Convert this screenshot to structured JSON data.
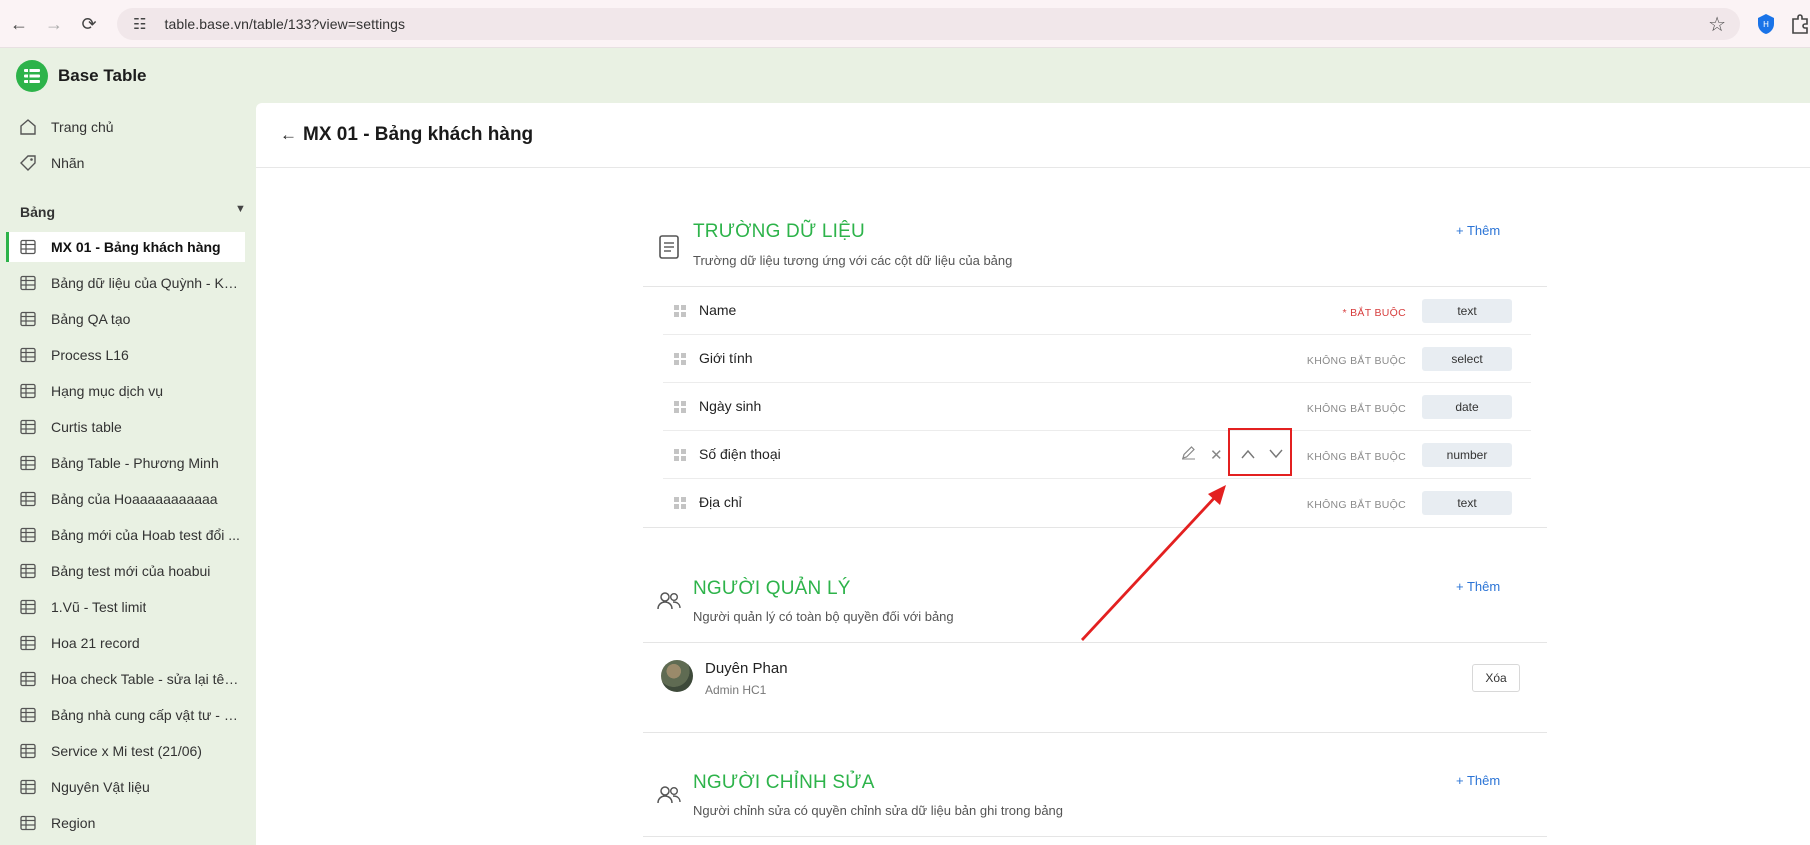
{
  "browser": {
    "url": "table.base.vn/table/133?view=settings"
  },
  "app": {
    "title": "Base Table",
    "brand_color": "#2db34a"
  },
  "sidebar": {
    "top_items": [
      {
        "label": "Trang chủ",
        "icon": "home-icon"
      },
      {
        "label": "Nhãn",
        "icon": "tag-icon"
      }
    ],
    "section_label": "Bảng",
    "tables": [
      {
        "label": "MX 01 - Bảng khách hàng",
        "active": true
      },
      {
        "label": "Bảng dữ liệu của Quỳnh - KH..."
      },
      {
        "label": "Bảng QA tạo"
      },
      {
        "label": "Process L16"
      },
      {
        "label": "Hạng mục dịch vụ"
      },
      {
        "label": "Curtis table"
      },
      {
        "label": "Bảng Table - Phương Minh"
      },
      {
        "label": "Bảng của Hoaaaaaaaaaaa"
      },
      {
        "label": "Bảng mới của Hoab test đổi ..."
      },
      {
        "label": "Bảng test mới của hoabui"
      },
      {
        "label": "1.Vũ - Test limit"
      },
      {
        "label": "Hoa 21 record"
      },
      {
        "label": "Hoa check Table - sửa lại tên..."
      },
      {
        "label": "Bảng nhà cung cấp vật tư - CE"
      },
      {
        "label": "Service x Mi test (21/06)"
      },
      {
        "label": "Nguyên Vật liệu"
      },
      {
        "label": "Region"
      }
    ]
  },
  "page": {
    "title": "MX 01 - Bảng khách hàng"
  },
  "fields_section": {
    "title": "TRƯỜNG DỮ LIỆU",
    "description": "Trường dữ liệu tương ứng với các cột dữ liệu của bảng",
    "add_label": "+ Thêm",
    "fields": [
      {
        "name": "Name",
        "requirement": "* BẮT BUỘC",
        "required": true,
        "type": "text"
      },
      {
        "name": "Giới tính",
        "requirement": "KHÔNG BẮT BUỘC",
        "required": false,
        "type": "select"
      },
      {
        "name": "Ngày sinh",
        "requirement": "KHÔNG BẮT BUỘC",
        "required": false,
        "type": "date"
      },
      {
        "name": "Số điện thoại",
        "requirement": "KHÔNG BẮT BUỘC",
        "required": false,
        "type": "number"
      },
      {
        "name": "Địa chỉ",
        "requirement": "KHÔNG BẮT BUỘC",
        "required": false,
        "type": "text"
      }
    ]
  },
  "managers_section": {
    "title": "NGƯỜI QUẢN LÝ",
    "description": "Người quản lý có toàn bộ quyền đối với bảng",
    "add_label": "+ Thêm",
    "users": [
      {
        "name": "Duyên Phan",
        "role": "Admin HC1",
        "remove_label": "Xóa"
      }
    ]
  },
  "editors_section": {
    "title": "NGƯỜI CHỈNH SỬA",
    "description": "Người chỉnh sửa có quyền chỉnh sửa dữ liệu bản ghi trong bảng",
    "add_label": "+ Thêm"
  },
  "annotation_color": "#e32020"
}
